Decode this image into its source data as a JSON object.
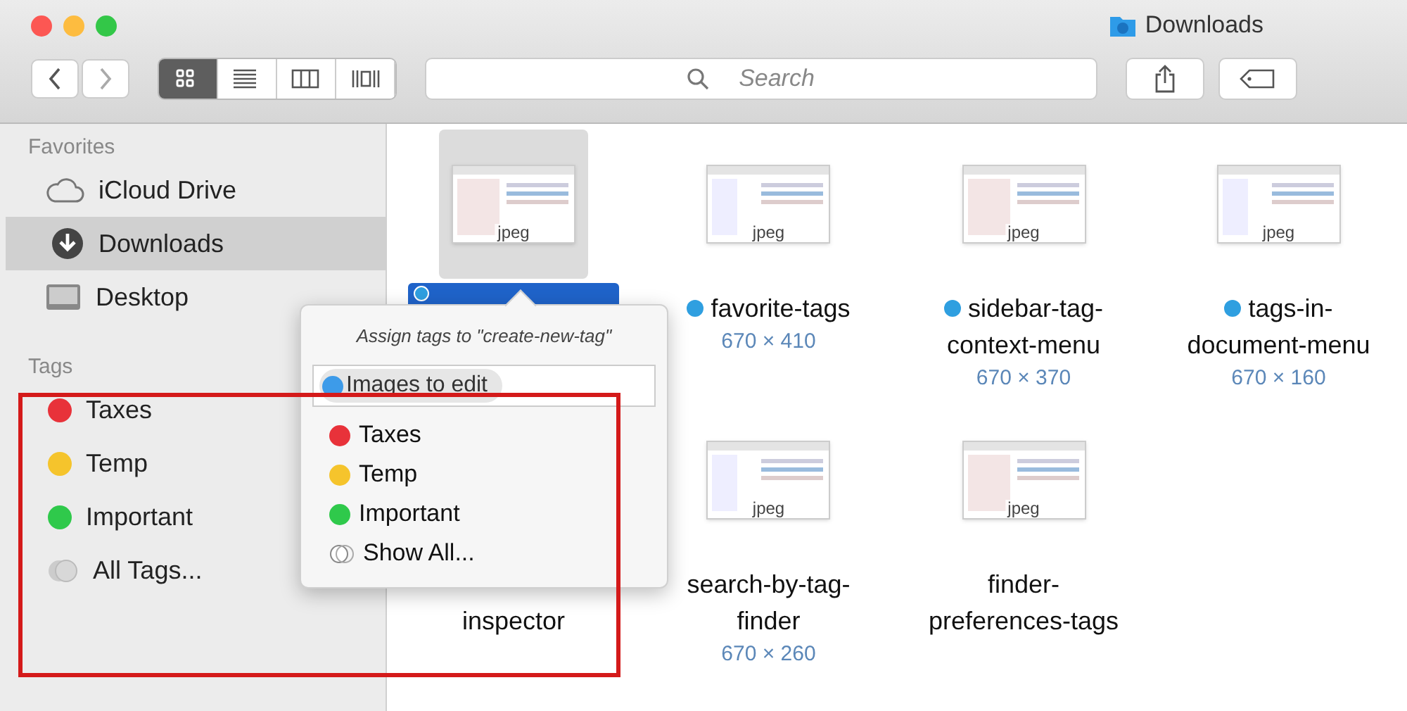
{
  "window": {
    "title": "Downloads"
  },
  "toolbar": {
    "views": [
      {
        "kind": "icons",
        "selected": true
      },
      {
        "kind": "list",
        "selected": false
      },
      {
        "kind": "columns",
        "selected": false
      },
      {
        "kind": "coverflow",
        "selected": false
      }
    ],
    "search": {
      "placeholder": "Search"
    }
  },
  "sidebar": {
    "sections": [
      {
        "title": "Favorites",
        "items": [
          {
            "label": "iCloud Drive",
            "kind": "cloud",
            "selected": false
          },
          {
            "label": "Downloads",
            "kind": "download",
            "selected": true
          },
          {
            "label": "Desktop",
            "kind": "desktop",
            "selected": false
          }
        ]
      },
      {
        "title": "Tags",
        "items": [
          {
            "label": "Taxes",
            "kind": "tag",
            "color": "#e8323a",
            "selected": false
          },
          {
            "label": "Temp",
            "kind": "tag",
            "color": "#f5c42c",
            "selected": false
          },
          {
            "label": "Important",
            "kind": "tag",
            "color": "#2fc94b",
            "selected": false
          },
          {
            "label": "All Tags...",
            "kind": "all",
            "selected": false
          }
        ]
      }
    ]
  },
  "files": [
    {
      "thumb_label": "jpeg",
      "selected": true,
      "color": "#2f9fe0"
    },
    {
      "thumb_label": "jpeg",
      "selected": false,
      "name_lines": [
        "favorite-tags"
      ],
      "size": "670 × 410",
      "color": "#2f9fe0"
    },
    {
      "thumb_label": "jpeg",
      "selected": false,
      "name_lines": [
        "sidebar-tag-",
        "context-menu"
      ],
      "size": "670 × 370",
      "color": "#2f9fe0"
    },
    {
      "thumb_label": "jpeg",
      "selected": false,
      "name_lines": [
        "tags-in-",
        "document-menu"
      ],
      "size": "670 × 160",
      "color": "#2f9fe0"
    },
    {
      "selected": false,
      "name_lines": [
        "inspector"
      ],
      "name_cut": true
    },
    {
      "thumb_label": "jpeg",
      "selected": false,
      "name_lines": [
        "search-by-tag-",
        "finder"
      ],
      "size": "670 × 260"
    },
    {
      "thumb_label": "jpeg",
      "selected": false,
      "name_lines": [
        "finder-",
        "preferences-tags"
      ]
    }
  ],
  "popover": {
    "title": "Assign tags to \"create-new-tag\"",
    "token": {
      "label": "Images to edit",
      "color": "#3d9be9"
    },
    "tags": [
      {
        "label": "Taxes",
        "kind": "tag",
        "color": "#e8323a"
      },
      {
        "label": "Temp",
        "kind": "tag",
        "color": "#f5c42c"
      },
      {
        "label": "Important",
        "kind": "tag",
        "color": "#2fc94b"
      },
      {
        "label": "Show All...",
        "kind": "all"
      }
    ]
  }
}
